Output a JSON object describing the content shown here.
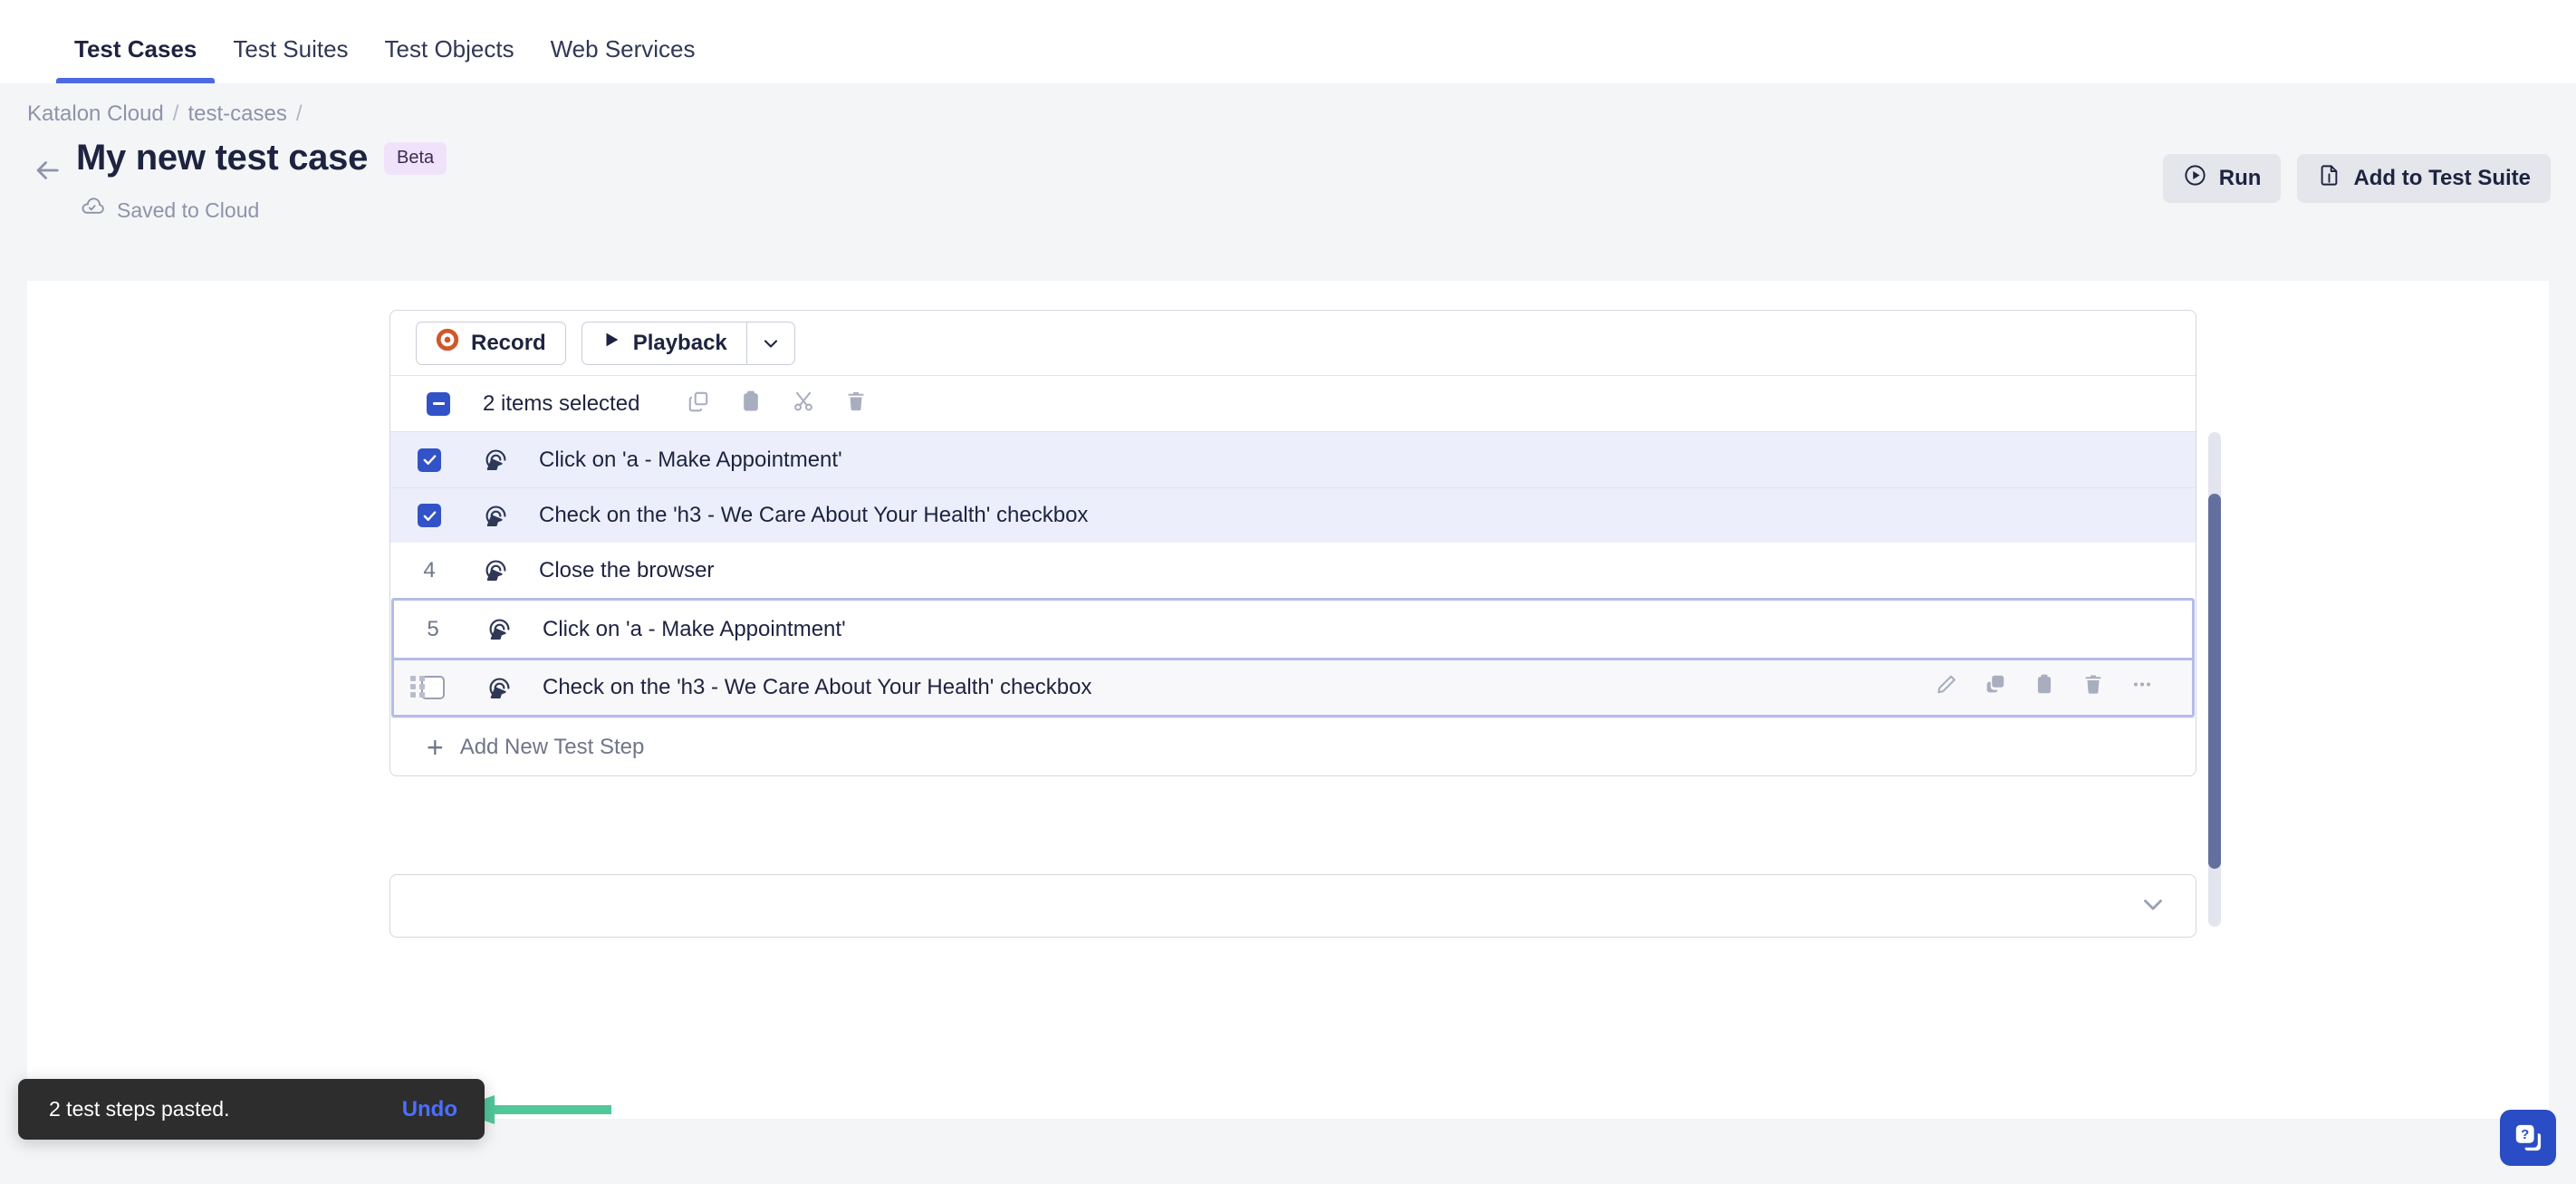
{
  "nav": {
    "tabs": [
      {
        "label": "Test Cases",
        "active": true
      },
      {
        "label": "Test Suites",
        "active": false
      },
      {
        "label": "Test Objects",
        "active": false
      },
      {
        "label": "Web Services",
        "active": false
      }
    ]
  },
  "breadcrumb": {
    "items": [
      "Katalon Cloud",
      "test-cases"
    ],
    "separator": "/"
  },
  "header": {
    "back_icon": "arrow-left-icon",
    "title": "My new test case",
    "badge": "Beta",
    "save_status": "Saved to Cloud",
    "save_icon": "cloud-check-icon",
    "buttons": [
      {
        "label": "Run",
        "icon": "play-circle-icon"
      },
      {
        "label": "Add to Test Suite",
        "icon": "file-add-icon"
      }
    ]
  },
  "toolbar": {
    "record_label": "Record",
    "record_icon": "record-dot-icon",
    "playback_label": "Playback",
    "playback_icon": "play-icon",
    "caret_icon": "chevron-down-icon"
  },
  "selection_bar": {
    "checkbox_state": "indeterminate",
    "count_label": "2 items selected",
    "actions": [
      {
        "name": "copy-icon",
        "title": "Copy"
      },
      {
        "name": "paste-icon",
        "title": "Paste"
      },
      {
        "name": "cut-icon",
        "title": "Cut"
      },
      {
        "name": "delete-icon",
        "title": "Delete"
      }
    ]
  },
  "steps": {
    "step_icon": "click-target-icon",
    "rows": [
      {
        "number": "",
        "checkbox": "checked",
        "text": "Click on 'a - Make Appointment'",
        "selected": true
      },
      {
        "number": "",
        "checkbox": "checked",
        "text": "Check on the 'h3 - We Care About Your Health' checkbox",
        "selected": true
      },
      {
        "number": "4",
        "checkbox": "",
        "text": "Close the browser",
        "selected": false
      }
    ],
    "pasted_rows": [
      {
        "number": "5",
        "checkbox": "",
        "text": "Click on 'a - Make Appointment'",
        "hover": false
      },
      {
        "number": "",
        "checkbox": "unchecked",
        "text": "Check on the 'h3 - We Care About Your Health' checkbox",
        "hover": true
      }
    ],
    "row_actions": [
      {
        "name": "edit-pencil-icon",
        "title": "Edit"
      },
      {
        "name": "copy-icon",
        "title": "Copy"
      },
      {
        "name": "paste-icon",
        "title": "Paste"
      },
      {
        "name": "delete-icon",
        "title": "Delete"
      },
      {
        "name": "more-icon",
        "title": "More"
      }
    ],
    "add_label": "Add New Test Step",
    "add_icon": "plus-icon"
  },
  "bottom_panel": {
    "expand_icon": "chevron-down-icon"
  },
  "toast": {
    "message": "2 test steps pasted.",
    "action_label": "Undo"
  },
  "annotation": {
    "type": "arrow-left",
    "color": "#52c79a",
    "points_at": "Undo"
  },
  "help_widget": {
    "icon": "help-chat-icon",
    "color": "#2a4cc4"
  }
}
